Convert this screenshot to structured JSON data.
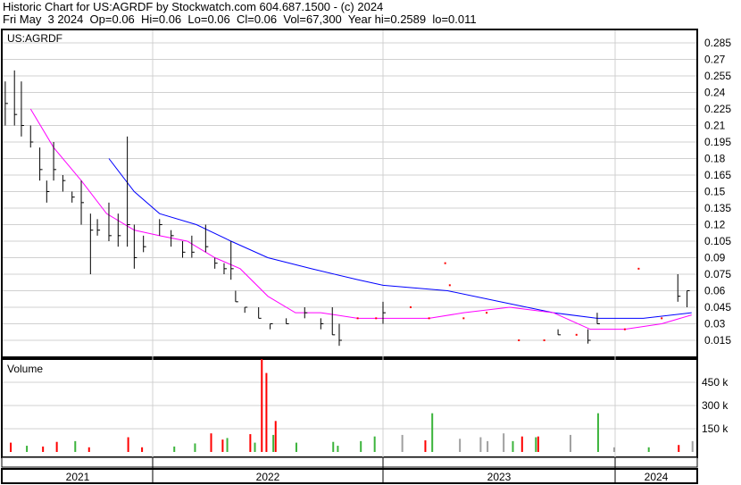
{
  "header": {
    "title": "Historic Chart for US:AGRDF by Stockwatch.com 604.687.1500 - (c) 2024",
    "quote": "Fri May  3 2024  Op=0.06  Hi=0.06  Lo=0.06  Cl=0.06  Vol=67,300  Year hi=0.2589  lo=0.011"
  },
  "colors": {
    "up": "#3cb43c",
    "down": "#ff0000",
    "flat": "#a0a0a0",
    "ma_long": "#0000ff",
    "ma_short": "#ff00ff"
  },
  "chart_data": {
    "type": "line",
    "symbol": "US:AGRDF",
    "price_axis": {
      "ylim": [
        0.0,
        0.295
      ],
      "ticks": [
        "0.285",
        "0.27",
        "0.255",
        "0.24",
        "0.225",
        "0.21",
        "0.195",
        "0.18",
        "0.165",
        "0.15",
        "0.135",
        "0.12",
        "0.105",
        "0.09",
        "0.075",
        "0.06",
        "0.045",
        "0.03",
        "0.015"
      ]
    },
    "x_axis": {
      "labels": [
        "2021",
        "2022",
        "2023",
        "2024"
      ]
    },
    "ohlc": [
      [
        2021.36,
        0.25,
        0.21,
        0.23
      ],
      [
        2021.4,
        0.26,
        0.21,
        0.22
      ],
      [
        2021.43,
        0.25,
        0.2,
        0.21
      ],
      [
        2021.47,
        0.21,
        0.19,
        0.195
      ],
      [
        2021.51,
        0.19,
        0.16,
        0.17
      ],
      [
        2021.54,
        0.16,
        0.14,
        0.15
      ],
      [
        2021.57,
        0.195,
        0.16,
        0.17
      ],
      [
        2021.61,
        0.165,
        0.15,
        0.16
      ],
      [
        2021.65,
        0.15,
        0.14,
        0.145
      ],
      [
        2021.69,
        0.16,
        0.12,
        0.14
      ],
      [
        2021.73,
        0.13,
        0.075,
        0.115
      ],
      [
        2021.76,
        0.125,
        0.11,
        0.115
      ],
      [
        2021.81,
        0.14,
        0.105,
        0.11
      ],
      [
        2021.85,
        0.13,
        0.1,
        0.11
      ],
      [
        2021.89,
        0.2,
        0.1,
        0.12
      ],
      [
        2021.92,
        0.12,
        0.08,
        0.09
      ],
      [
        2021.96,
        0.11,
        0.095,
        0.1
      ],
      [
        2022.03,
        0.125,
        0.11,
        0.12
      ],
      [
        2022.08,
        0.115,
        0.1,
        0.11
      ],
      [
        2022.13,
        0.105,
        0.09,
        0.095
      ],
      [
        2022.17,
        0.11,
        0.09,
        0.095
      ],
      [
        2022.23,
        0.12,
        0.095,
        0.1
      ],
      [
        2022.27,
        0.09,
        0.08,
        0.085
      ],
      [
        2022.31,
        0.085,
        0.075,
        0.08
      ],
      [
        2022.34,
        0.105,
        0.07,
        0.08
      ],
      [
        2022.36,
        0.06,
        0.05,
        0.05
      ],
      [
        2022.4,
        0.045,
        0.04,
        0.045
      ],
      [
        2022.46,
        0.045,
        0.035,
        0.035
      ],
      [
        2022.51,
        0.03,
        0.025,
        0.03
      ],
      [
        2022.58,
        0.035,
        0.03,
        0.03
      ],
      [
        2022.66,
        0.045,
        0.035,
        0.04
      ],
      [
        2022.73,
        0.035,
        0.025,
        0.03
      ],
      [
        2022.78,
        0.045,
        0.02,
        0.02
      ],
      [
        2022.81,
        0.03,
        0.01,
        0.015
      ],
      [
        2022.89,
        0.035,
        0.035,
        0.035
      ],
      [
        2022.97,
        0.035,
        0.035,
        0.035
      ],
      [
        2023.0,
        0.05,
        0.03,
        0.04
      ],
      [
        2023.12,
        0.045,
        0.045,
        0.045
      ],
      [
        2023.2,
        0.035,
        0.035,
        0.035
      ],
      [
        2023.27,
        0.085,
        0.085,
        0.085
      ],
      [
        2023.29,
        0.065,
        0.065,
        0.065
      ],
      [
        2023.35,
        0.035,
        0.035,
        0.035
      ],
      [
        2023.45,
        0.04,
        0.04,
        0.04
      ],
      [
        2023.59,
        0.015,
        0.015,
        0.015
      ],
      [
        2023.7,
        0.015,
        0.015,
        0.015
      ],
      [
        2023.76,
        0.025,
        0.02,
        0.02
      ],
      [
        2023.84,
        0.02,
        0.02,
        0.02
      ],
      [
        2023.89,
        0.025,
        0.012,
        0.015
      ],
      [
        2023.93,
        0.04,
        0.03,
        0.03
      ],
      [
        2024.05,
        0.025,
        0.025,
        0.025
      ],
      [
        2024.11,
        0.08,
        0.08,
        0.08
      ],
      [
        2024.21,
        0.035,
        0.035,
        0.035
      ],
      [
        2024.28,
        0.075,
        0.05,
        0.055
      ],
      [
        2024.32,
        0.06,
        0.045,
        0.06
      ]
    ],
    "ma_long": [
      [
        2021.81,
        0.18
      ],
      [
        2021.92,
        0.15
      ],
      [
        2022.03,
        0.13
      ],
      [
        2022.19,
        0.12
      ],
      [
        2022.34,
        0.105
      ],
      [
        2022.5,
        0.09
      ],
      [
        2022.69,
        0.08
      ],
      [
        2022.89,
        0.07
      ],
      [
        2023.0,
        0.065
      ],
      [
        2023.28,
        0.06
      ],
      [
        2023.51,
        0.05
      ],
      [
        2023.74,
        0.04
      ],
      [
        2023.93,
        0.035
      ],
      [
        2024.13,
        0.035
      ],
      [
        2024.34,
        0.04
      ]
    ],
    "ma_short": [
      [
        2021.47,
        0.225
      ],
      [
        2021.57,
        0.19
      ],
      [
        2021.69,
        0.16
      ],
      [
        2021.8,
        0.13
      ],
      [
        2021.92,
        0.115
      ],
      [
        2022.03,
        0.11
      ],
      [
        2022.15,
        0.105
      ],
      [
        2022.27,
        0.09
      ],
      [
        2022.38,
        0.08
      ],
      [
        2022.5,
        0.055
      ],
      [
        2022.62,
        0.04
      ],
      [
        2022.73,
        0.04
      ],
      [
        2022.89,
        0.035
      ],
      [
        2023.04,
        0.035
      ],
      [
        2023.2,
        0.035
      ],
      [
        2023.35,
        0.04
      ],
      [
        2023.55,
        0.045
      ],
      [
        2023.74,
        0.04
      ],
      [
        2023.9,
        0.025
      ],
      [
        2024.05,
        0.025
      ],
      [
        2024.21,
        0.03
      ],
      [
        2024.34,
        0.038
      ]
    ],
    "volume": {
      "label": "Volume",
      "ticks": [
        "450 k",
        "300 k",
        "150 k"
      ],
      "ylim": [
        0,
        650000
      ],
      "bars": [
        [
          2021.38,
          60000,
          "down"
        ],
        [
          2021.45,
          40000,
          "up"
        ],
        [
          2021.52,
          35000,
          "down"
        ],
        [
          2021.58,
          65000,
          "down"
        ],
        [
          2021.66,
          70000,
          "up"
        ],
        [
          2021.72,
          30000,
          "down"
        ],
        [
          2021.89,
          95000,
          "down"
        ],
        [
          2021.95,
          30000,
          "down"
        ],
        [
          2022.09,
          35000,
          "up"
        ],
        [
          2022.18,
          55000,
          "up"
        ],
        [
          2022.25,
          120000,
          "down"
        ],
        [
          2022.3,
          80000,
          "down"
        ],
        [
          2022.32,
          90000,
          "up"
        ],
        [
          2022.52,
          110000,
          "up"
        ],
        [
          2022.62,
          60000,
          "up"
        ],
        [
          2022.78,
          65000,
          "up"
        ],
        [
          2022.9,
          70000,
          "up"
        ],
        [
          2022.96,
          100000,
          "up"
        ],
        [
          2023.08,
          110000,
          "flat"
        ],
        [
          2023.18,
          75000,
          "down"
        ],
        [
          2023.33,
          85000,
          "flat"
        ],
        [
          2023.42,
          95000,
          "flat"
        ],
        [
          2023.45,
          70000,
          "flat"
        ],
        [
          2023.52,
          120000,
          "flat"
        ],
        [
          2023.56,
          70000,
          "up"
        ],
        [
          2023.6,
          100000,
          "down"
        ],
        [
          2023.66,
          95000,
          "up"
        ],
        [
          2023.67,
          100000,
          "down"
        ],
        [
          2023.81,
          110000,
          "flat"
        ],
        [
          2023.93,
          250000,
          "up"
        ],
        [
          2024.0,
          30000,
          "flat"
        ],
        [
          2024.15,
          30000,
          "up"
        ],
        [
          2024.28,
          45000,
          "down"
        ],
        [
          2024.34,
          70000,
          "flat"
        ],
        [
          2022.47,
          600000,
          "down"
        ],
        [
          2022.49,
          510000,
          "down"
        ],
        [
          2022.53,
          200000,
          "down"
        ],
        [
          2023.21,
          250000,
          "up"
        ],
        [
          2022.42,
          115000,
          "down"
        ],
        [
          2022.44,
          60000,
          "up"
        ],
        [
          2022.8,
          40000,
          "up"
        ]
      ]
    }
  }
}
